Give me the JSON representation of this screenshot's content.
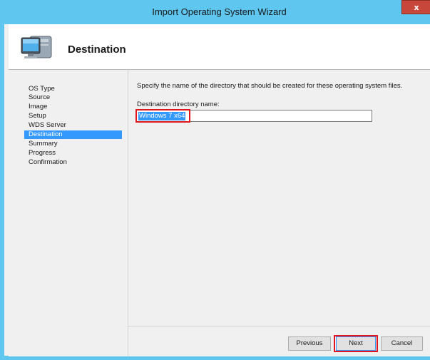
{
  "window": {
    "title": "Import Operating System Wizard",
    "close_label": "x"
  },
  "header": {
    "title": "Destination",
    "icon": "computer-icon"
  },
  "nav": {
    "items": [
      {
        "label": "OS Type",
        "selected": false
      },
      {
        "label": "Source",
        "selected": false
      },
      {
        "label": "Image",
        "selected": false
      },
      {
        "label": "Setup",
        "selected": false
      },
      {
        "label": "WDS Server",
        "selected": false
      },
      {
        "label": "Destination",
        "selected": true
      },
      {
        "label": "Summary",
        "selected": false
      },
      {
        "label": "Progress",
        "selected": false
      },
      {
        "label": "Confirmation",
        "selected": false
      }
    ]
  },
  "content": {
    "instruction": "Specify the name of the directory that should be created for these operating system files.",
    "field_label": "Destination directory name:",
    "field_value": "Windows 7 x64"
  },
  "buttons": {
    "previous": "Previous",
    "next": "Next",
    "cancel": "Cancel"
  },
  "colors": {
    "titlebar": "#5ec6ef",
    "selection": "#3399ff",
    "annotation": "#e0161e"
  }
}
